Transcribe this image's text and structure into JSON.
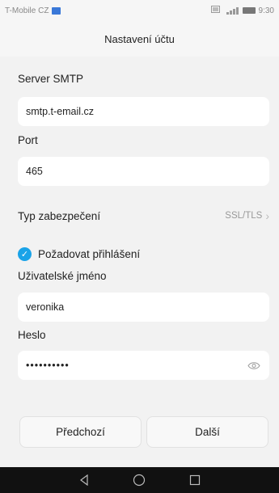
{
  "status": {
    "carrier": "T-Mobile CZ",
    "time": "9:30",
    "icons": [
      "carrier-logo-icon",
      "notification-icon",
      "signal-icon",
      "battery-icon"
    ]
  },
  "header": {
    "title": "Nastavení účtu"
  },
  "form": {
    "smtp_label": "Server SMTP",
    "smtp_value": "smtp.t-email.cz",
    "port_label": "Port",
    "port_value": "465",
    "security_label": "Typ zabezpečení",
    "security_value": "SSL/TLS",
    "require_login_label": "Požadovat přihlášení",
    "require_login_checked": true,
    "username_label": "Uživatelské jméno",
    "username_value": "veronika",
    "password_label": "Heslo",
    "password_value": "••••••••••"
  },
  "buttons": {
    "previous": "Předchozí",
    "next": "Další"
  },
  "colors": {
    "accent": "#1aa3e8",
    "background": "#f2f2f2",
    "navbar": "#111111"
  }
}
